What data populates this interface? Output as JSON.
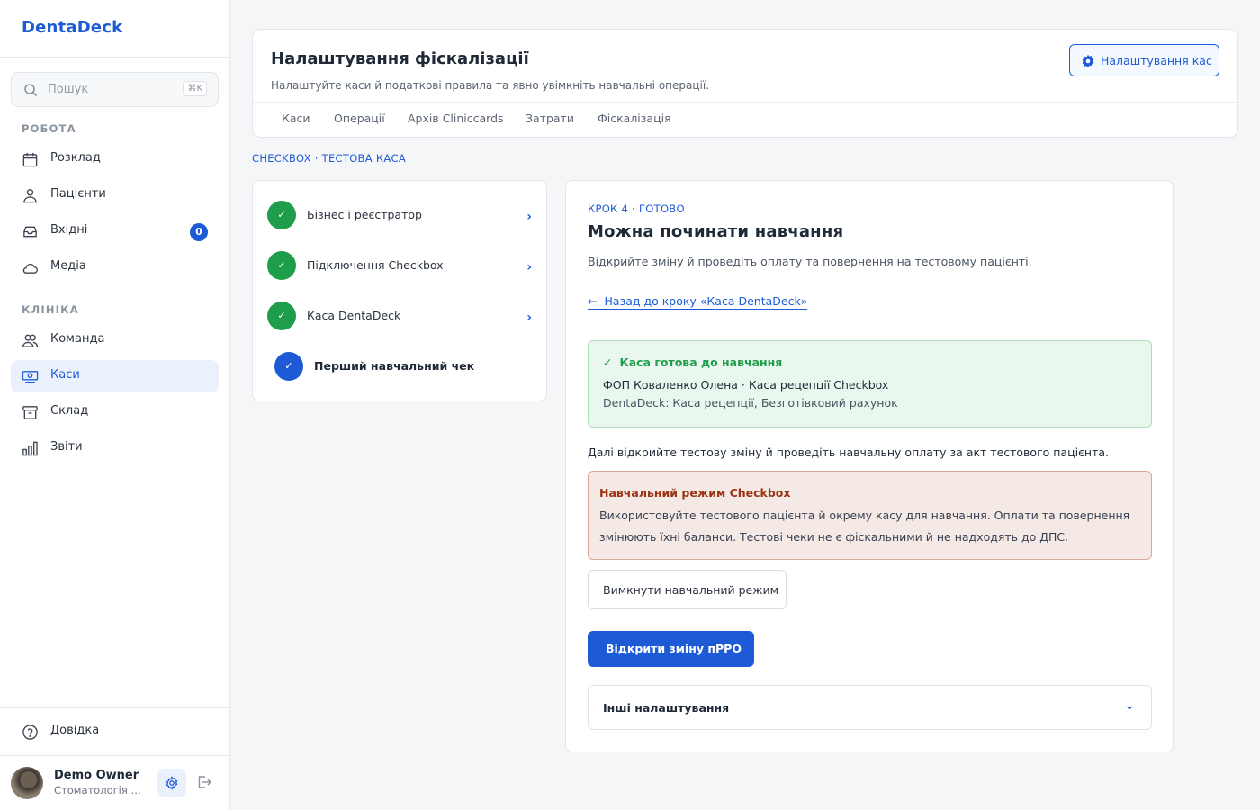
{
  "app": {
    "name": "DentaDeck"
  },
  "search": {
    "placeholder": "Пошук",
    "shortcut": "⌘K"
  },
  "sidebar": {
    "sections": [
      {
        "label": "РОБОТА",
        "items": [
          {
            "label": "Розклад",
            "icon": "calendar-icon"
          },
          {
            "label": "Пацієнти",
            "icon": "patients-icon"
          },
          {
            "label": "Вхідні",
            "icon": "inbox-icon",
            "badge": "0"
          },
          {
            "label": "Медіа",
            "icon": "cloud-icon"
          }
        ]
      },
      {
        "label": "КЛІНІКА",
        "items": [
          {
            "label": "Команда",
            "icon": "team-icon"
          },
          {
            "label": "Каси",
            "icon": "cash-register-icon",
            "active": true
          },
          {
            "label": "Склад",
            "icon": "archive-icon"
          },
          {
            "label": "Звіти",
            "icon": "bar-chart-icon"
          }
        ]
      }
    ],
    "help": "Довідка",
    "user": {
      "name": "Demo Owner",
      "org": "Стоматологія Приклад"
    }
  },
  "header": {
    "title": "Налаштування фіскалізації",
    "subtitle": "Налаштуйте каси й податкові правила та явно увімкніть навчальні операції.",
    "settings_button": "Налаштування кас",
    "tabs": [
      "Каси",
      "Операції",
      "Архів Cliniccards",
      "Затрати",
      "Фіскалізація"
    ]
  },
  "breadcrumb": "CHECKBOX · ТЕСТОВА КАСА",
  "steps": [
    {
      "label": "Бізнес і реєстратор",
      "status": "done",
      "mark": "✓"
    },
    {
      "label": "Підключення Checkbox",
      "status": "done",
      "mark": "✓"
    },
    {
      "label": "Каса DentaDeck",
      "status": "done",
      "mark": "✓"
    },
    {
      "label": "Перший навчальний чек",
      "status": "current",
      "mark": "✓"
    }
  ],
  "main": {
    "kicker": "КРОК 4 · ГОТОВО",
    "title": "Можна починати навчання",
    "subtitle": "Відкрийте зміну й проведіть оплату та повернення на тестовому пацієнті.",
    "back_arrow": "←",
    "back_link": "Назад до кроку «Каса DentaDeck»",
    "ready": {
      "check": "✓",
      "title": "Каса готова до навчання",
      "line1": "ФОП Коваленко Олена · Каса рецепції Checkbox",
      "line2": "DentaDeck: Каса рецепції, Безготівковий рахунок"
    },
    "next_text": "Далі відкрийте тестову зміну й проведіть навчальну оплату за акт тестового пацієнта.",
    "warning": {
      "title": "Навчальний режим Checkbox",
      "text": "Використовуйте тестового пацієнта й окрему касу для навчання. Оплати та повернення змінюють їхні баланси. Тестові чеки не є фіскальними й не надходять до ДПС."
    },
    "disable_button": "Вимкнути навчальний режим",
    "open_button": "Відкрити зміну пРРО",
    "other_settings": "Інші налаштування"
  },
  "colors": {
    "accent": "#1d5bd6",
    "success": "#1e9e4a",
    "warning_text": "#9a3412"
  }
}
